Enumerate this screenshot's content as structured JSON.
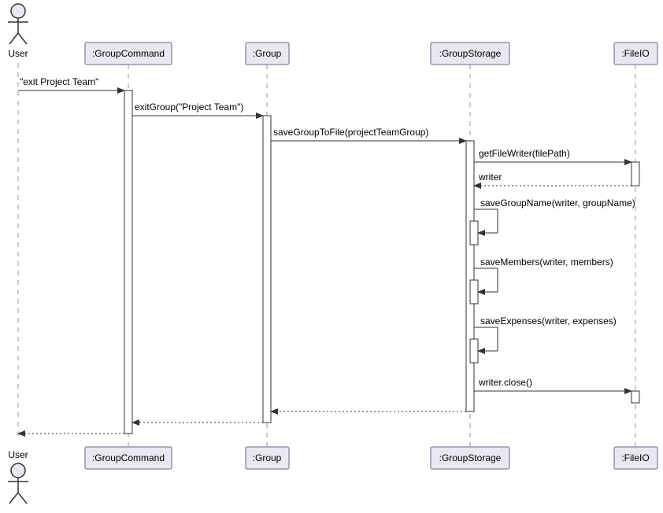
{
  "diagram": {
    "type": "uml-sequence",
    "actor": {
      "name": "User"
    },
    "participants": [
      {
        "id": "gc",
        "label": ":GroupCommand"
      },
      {
        "id": "g",
        "label": ":Group"
      },
      {
        "id": "gs",
        "label": ":GroupStorage"
      },
      {
        "id": "fio",
        "label": ":FileIO"
      }
    ],
    "messages": [
      {
        "from": "user",
        "to": "gc",
        "label": "\"exit Project Team\"",
        "style": "solid"
      },
      {
        "from": "gc",
        "to": "g",
        "label": "exitGroup(\"Project Team\")",
        "style": "solid"
      },
      {
        "from": "g",
        "to": "gs",
        "label": "saveGroupToFile(projectTeamGroup)",
        "style": "solid"
      },
      {
        "from": "gs",
        "to": "fio",
        "label": "getFileWriter(filePath)",
        "style": "solid"
      },
      {
        "from": "fio",
        "to": "gs",
        "label": "writer",
        "style": "dashed"
      },
      {
        "from": "gs",
        "to": "gs",
        "label": "saveGroupName(writer, groupName)",
        "style": "solid",
        "self": true
      },
      {
        "from": "gs",
        "to": "gs",
        "label": "saveMembers(writer, members)",
        "style": "solid",
        "self": true
      },
      {
        "from": "gs",
        "to": "gs",
        "label": "saveExpenses(writer, expenses)",
        "style": "solid",
        "self": true
      },
      {
        "from": "gs",
        "to": "fio",
        "label": "writer.close()",
        "style": "solid"
      },
      {
        "from": "gs",
        "to": "g",
        "label": "",
        "style": "dashed"
      },
      {
        "from": "g",
        "to": "gc",
        "label": "",
        "style": "dashed"
      },
      {
        "from": "gc",
        "to": "user",
        "label": "",
        "style": "dashed"
      }
    ]
  }
}
